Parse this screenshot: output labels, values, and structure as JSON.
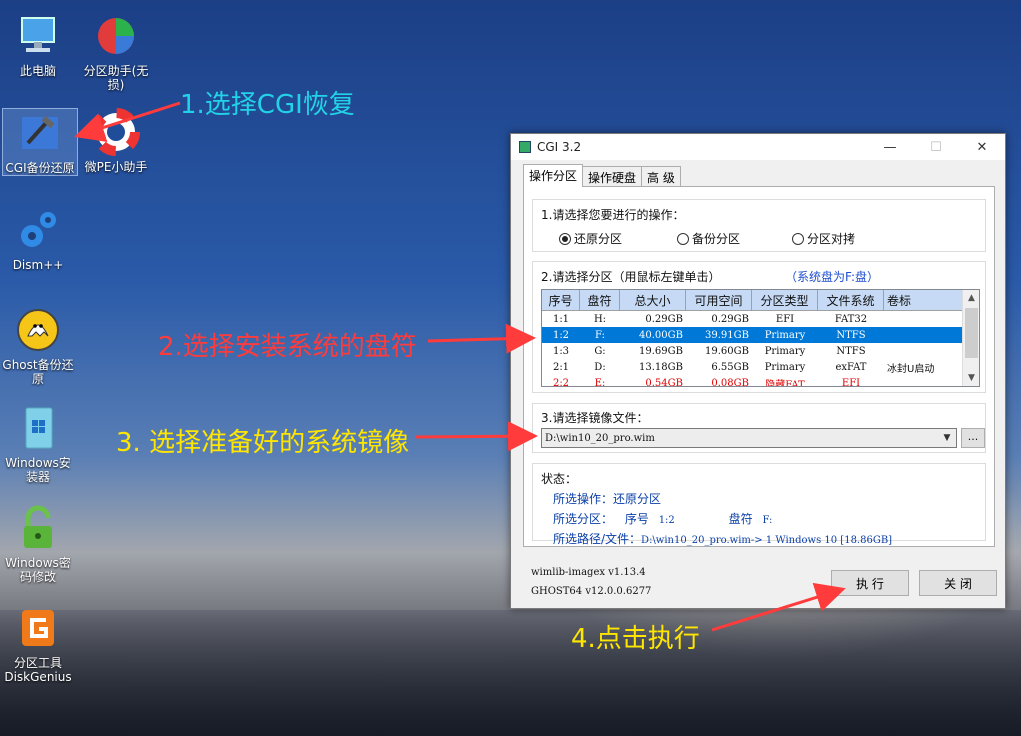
{
  "desktop": {
    "icons": [
      {
        "label": "此电脑",
        "icon": "computer-icon"
      },
      {
        "label": "分区助手(无损)",
        "icon": "partition-assistant-icon"
      },
      {
        "label": "CGI备份还原",
        "icon": "cgi-backup-icon"
      },
      {
        "label": "微PE小助手",
        "icon": "lifebuoy-icon"
      },
      {
        "label": "Dism++",
        "icon": "gears-icon"
      },
      {
        "label": "Ghost备份还原",
        "icon": "ghost-icon"
      },
      {
        "label": "Windows安装器",
        "icon": "windows-installer-icon"
      },
      {
        "label": "Windows密码修改",
        "icon": "lock-icon"
      },
      {
        "label": "分区工具DiskGenius",
        "icon": "diskgenius-icon"
      }
    ]
  },
  "annotations": {
    "step1": "1.选择CGI恢复",
    "step2": "2.选择安装系统的盘符",
    "step3": "3. 选择准备好的系统镜像",
    "step4": "4.点击执行",
    "colors": {
      "step1": "#22d3e8",
      "step2": "#ff3b3b",
      "step3": "#ffe600",
      "step4": "#ffe600",
      "arrow": "#ff3b3b"
    }
  },
  "window": {
    "title": "CGI 3.2",
    "controls": {
      "minimize": "—",
      "maximize": "☐",
      "close": "✕"
    },
    "tabs": [
      "操作分区",
      "操作硬盘",
      "高 级"
    ],
    "op_group": {
      "label": "1.请选择您要进行的操作：",
      "options": [
        "还原分区",
        "备份分区",
        "分区对拷"
      ],
      "selected": "还原分区"
    },
    "part_group": {
      "label": "2.请选择分区（用鼠标左键单击）",
      "sysdisk_hint": "（系统盘为F:盘）",
      "columns": [
        "序号",
        "盘符",
        "总大小",
        "可用空间",
        "分区类型",
        "文件系统",
        "卷标"
      ],
      "rows": [
        {
          "no": "1:1",
          "drive": "H:",
          "total": "0.29GB",
          "free": "0.29GB",
          "type": "EFI",
          "fs": "FAT32",
          "label": ""
        },
        {
          "no": "1:2",
          "drive": "F:",
          "total": "40.00GB",
          "free": "39.91GB",
          "type": "Primary",
          "fs": "NTFS",
          "label": ""
        },
        {
          "no": "1:3",
          "drive": "G:",
          "total": "19.69GB",
          "free": "19.60GB",
          "type": "Primary",
          "fs": "NTFS",
          "label": ""
        },
        {
          "no": "2:1",
          "drive": "D:",
          "total": "13.18GB",
          "free": "6.55GB",
          "type": "Primary",
          "fs": "exFAT",
          "label": "冰封U启动"
        },
        {
          "no": "2:2",
          "drive": "E:",
          "total": "0.54GB",
          "free": "0.08GB",
          "type": "隐藏FAT",
          "fs": "EFI",
          "label": ""
        }
      ],
      "selected_row": 1
    },
    "image_group": {
      "label": "3.请选择镜像文件：",
      "value": "D:\\win10_20_pro.wim",
      "browse": "..."
    },
    "status": {
      "label": "状态：",
      "op_label": "所选操作：",
      "op_value": "还原分区",
      "part_label": "所选分区：",
      "part_no_label": "序号",
      "part_no": "1:2",
      "disk_label": "盘符",
      "disk": "F:",
      "path_label": "所选路径/文件：",
      "path_value": "D:\\win10_20_pro.wim-> 1 Windows 10 [18.86GB]"
    },
    "versions": {
      "wimlib": "wimlib-imagex v1.13.4",
      "ghost": "GHOST64 v12.0.0.6277"
    },
    "buttons": {
      "execute": "执 行",
      "close": "关 闭"
    }
  }
}
